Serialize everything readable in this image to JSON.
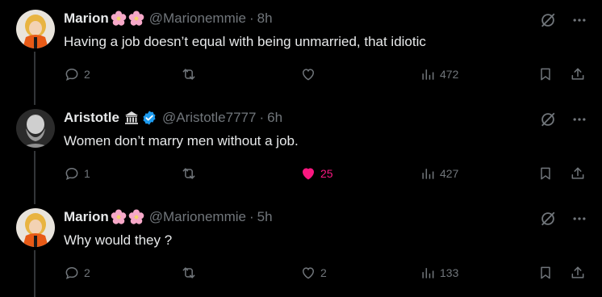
{
  "colors": {
    "background": "#000000",
    "text": "#e7e9ea",
    "muted": "#71767b",
    "like_active": "#f91880",
    "verified": "#1d9bf0"
  },
  "tweets": [
    {
      "name": "Marion",
      "name_emojis": [
        "cherry-blossom",
        "cherry-blossom"
      ],
      "handle": "@Marionemmie",
      "time": "8h",
      "text": "Having a job doesn’t equal with being unmarried, that idiotic",
      "replies": "2",
      "retweets": "",
      "likes": "",
      "views": "472",
      "liked": false
    },
    {
      "name": "Aristotle",
      "name_emojis": [
        "classical-building",
        "verified-badge"
      ],
      "handle": "@Aristotle7777",
      "time": "6h",
      "text": "Women don’t marry men without a job.",
      "replies": "1",
      "retweets": "",
      "likes": "25",
      "views": "427",
      "liked": true
    },
    {
      "name": "Marion",
      "name_emojis": [
        "cherry-blossom",
        "cherry-blossom"
      ],
      "handle": "@Marionemmie",
      "time": "5h",
      "text": "Why would they ?",
      "replies": "2",
      "retweets": "",
      "likes": "2",
      "views": "133",
      "liked": false
    }
  ],
  "separator": "·"
}
